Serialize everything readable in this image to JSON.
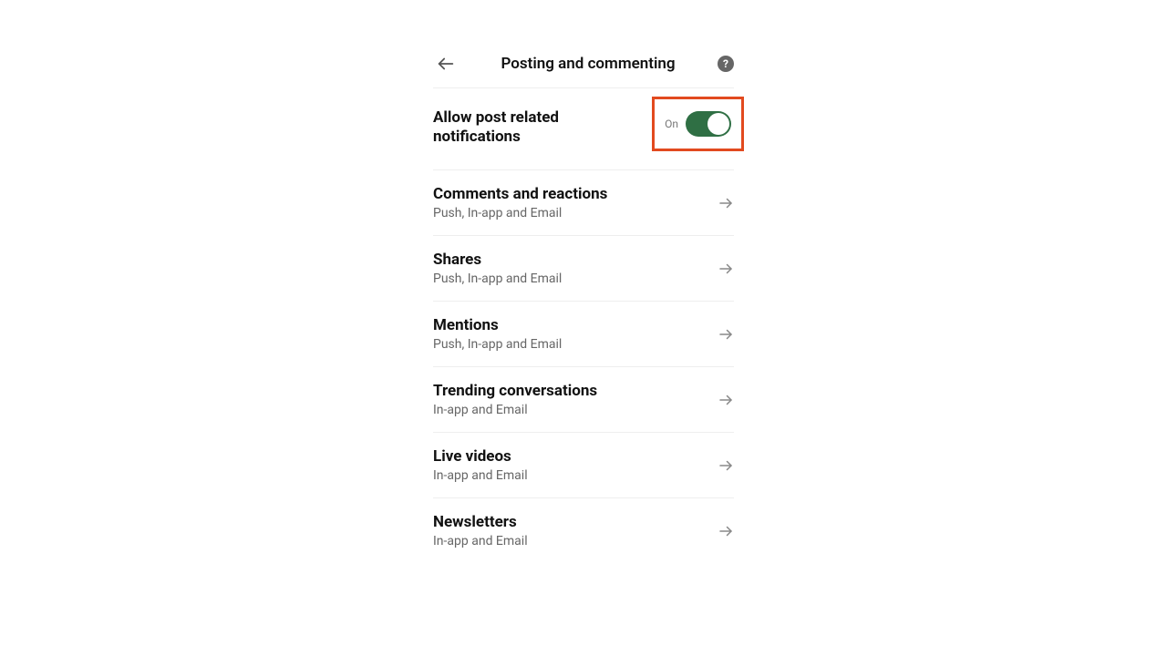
{
  "header": {
    "title": "Posting and commenting"
  },
  "master": {
    "label": "Allow post related notifications",
    "state_label": "On",
    "highlighted": true
  },
  "settings": [
    {
      "title": "Comments and reactions",
      "subtitle": "Push, In-app and Email"
    },
    {
      "title": "Shares",
      "subtitle": "Push, In-app and Email"
    },
    {
      "title": "Mentions",
      "subtitle": "Push, In-app and Email"
    },
    {
      "title": "Trending conversations",
      "subtitle": "In-app and Email"
    },
    {
      "title": "Live videos",
      "subtitle": "In-app and Email"
    },
    {
      "title": "Newsletters",
      "subtitle": "In-app and Email"
    }
  ]
}
